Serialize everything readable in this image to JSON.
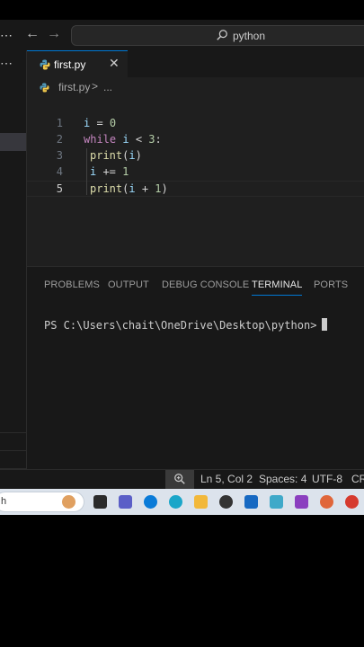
{
  "titlebar": {
    "menu_dots": "⋯",
    "search_text": "python"
  },
  "tab": {
    "label": "first.py",
    "close": "✕"
  },
  "breadcrumb": {
    "file": "first.py",
    "separator": ">",
    "more": "..."
  },
  "code": [
    {
      "num": "1",
      "tokens": [
        [
          "var",
          "i"
        ],
        [
          "op",
          " = "
        ],
        [
          "num",
          "0"
        ]
      ]
    },
    {
      "num": "2",
      "tokens": [
        [
          "kw",
          "while"
        ],
        [
          "op",
          " "
        ],
        [
          "var",
          "i"
        ],
        [
          "op",
          " < "
        ],
        [
          "num",
          "3"
        ],
        [
          "op",
          ":"
        ]
      ]
    },
    {
      "num": "3",
      "tokens": [
        [
          "fn",
          "print"
        ],
        [
          "op",
          "("
        ],
        [
          "var",
          "i"
        ],
        [
          "op",
          ")"
        ]
      ]
    },
    {
      "num": "4",
      "tokens": [
        [
          "var",
          "i"
        ],
        [
          "op",
          " += "
        ],
        [
          "num",
          "1"
        ]
      ]
    },
    {
      "num": "5",
      "tokens": [
        [
          "fn",
          "print"
        ],
        [
          "op",
          "("
        ],
        [
          "var",
          "i"
        ],
        [
          "op",
          " + "
        ],
        [
          "num",
          "1"
        ],
        [
          "op",
          ")"
        ]
      ]
    }
  ],
  "panel": {
    "tabs": [
      "PROBLEMS",
      "OUTPUT",
      "DEBUG CONSOLE",
      "TERMINAL",
      "PORTS"
    ],
    "active_tab": "TERMINAL",
    "terminal_prompt": "PS C:\\Users\\chait\\OneDrive\\Desktop\\python>"
  },
  "status": {
    "position": "Ln 5, Col 2",
    "spaces": "Spaces: 4",
    "encoding": "UTF-8",
    "eol": "CR"
  },
  "taskbar": {
    "search_partial": "h"
  },
  "colors": {
    "accent": "#0078d4",
    "editor_bg": "#1f1f1f",
    "panel_bg": "#181818"
  }
}
